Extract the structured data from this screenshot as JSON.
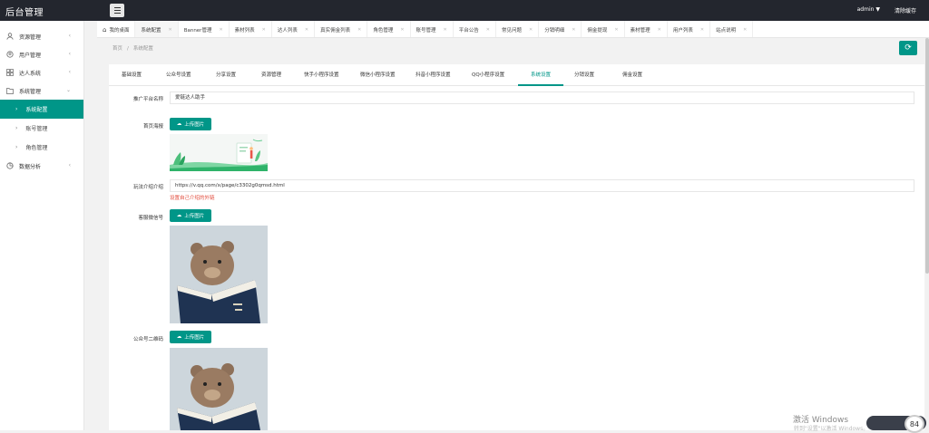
{
  "app": {
    "title": "后台管理"
  },
  "topbar": {
    "user": "admin",
    "clear_cache": "清除缓存"
  },
  "sidebar": {
    "items": [
      {
        "label": "资源管理",
        "icon": "user-icon"
      },
      {
        "label": "用户管理",
        "icon": "user-icon"
      },
      {
        "label": "达人系统",
        "icon": "grid-icon"
      },
      {
        "label": "系统管理",
        "icon": "folder-icon"
      }
    ],
    "subitems": [
      {
        "label": "系统配置",
        "active": true
      },
      {
        "label": "账号管理"
      },
      {
        "label": "角色管理"
      }
    ],
    "last": {
      "label": "数据分析",
      "icon": "chart-icon"
    }
  },
  "tabs": [
    {
      "label": "我的桌面"
    },
    {
      "label": "系统配置",
      "active": true
    },
    {
      "label": "Banner管理"
    },
    {
      "label": "素材列表"
    },
    {
      "label": "达人列表"
    },
    {
      "label": "真实佣金列表"
    },
    {
      "label": "角色管理"
    },
    {
      "label": "账号管理"
    },
    {
      "label": "平台公告"
    },
    {
      "label": "常见问题"
    },
    {
      "label": "分销明细"
    },
    {
      "label": "佣金提现"
    },
    {
      "label": "素材管理"
    },
    {
      "label": "用户列表"
    },
    {
      "label": "站点说明"
    }
  ],
  "breadcrumb": {
    "home": "首页",
    "sep": "/",
    "current": "系统配置"
  },
  "subtabs": [
    "基础设置",
    "公众号设置",
    "分享设置",
    "资源管理",
    "快手小程序设置",
    "微信小程序设置",
    "抖音小程序设置",
    "QQ小程序设置",
    "系统设置",
    "分销设置",
    "佣金设置"
  ],
  "form": {
    "platform_name_label": "推广平台名称",
    "platform_name_value": "爱链达人助手",
    "home_poster_label": "首页海报",
    "upload_label": "上传图片",
    "intro_label": "玩法介绍介绍",
    "intro_value": "https://v.qq.com/x/page/c3302g0qmsd.html",
    "intro_hint": "设置自己介绍的外链",
    "wechat_label": "客服微信号",
    "mp_qrcode_label": "公众号二维码"
  },
  "os": {
    "watermark": "激活 Windows",
    "watermark_sub": "转到\"设置\"以激活 Windows。",
    "perf_value": "84"
  },
  "colors": {
    "accent": "#009688",
    "topbar": "#23262e",
    "hint": "#e24b3c"
  }
}
